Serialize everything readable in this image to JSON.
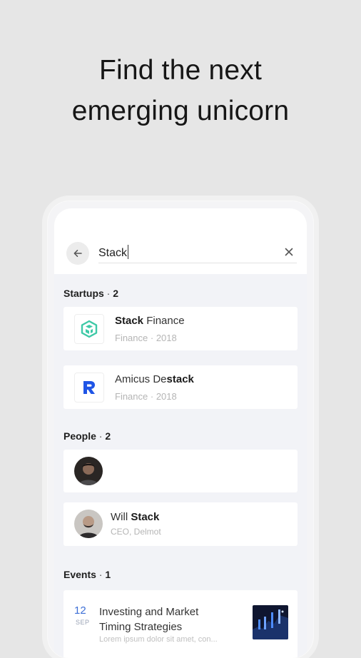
{
  "headline": {
    "line1": "Find the next",
    "line2": "emerging unicorn"
  },
  "search": {
    "query": "Stack"
  },
  "sections": {
    "startups": {
      "label": "Startups",
      "count": "2"
    },
    "people": {
      "label": "People",
      "count": "2"
    },
    "events": {
      "label": "Events",
      "count": "1"
    }
  },
  "startups": [
    {
      "name_highlight": "Stack",
      "name_rest": " Finance",
      "category": "Finance",
      "year": "2018",
      "logo": "stack-finance-logo",
      "logo_color": "#3ec9a7"
    },
    {
      "name_prefix": "Amicus De",
      "name_highlight": "stack",
      "category": "Finance",
      "year": "2018",
      "logo": "amicus-logo",
      "logo_color": "#1f55e6"
    }
  ],
  "people": [
    {
      "avatar": "avatar-person-1"
    },
    {
      "first_name": "Will ",
      "name_highlight": "Stack",
      "role": "CEO, Delmot",
      "avatar": "avatar-person-2"
    }
  ],
  "events": [
    {
      "day": "12",
      "month": "SEP",
      "title": "Investing and Market Timing Strategies",
      "description": "Lorem ipsum dolor sit amet, con..."
    }
  ],
  "colors": {
    "accent_date": "#3d6fd6",
    "page_bg": "#e6e6e6",
    "screen_bg": "#f2f3f7"
  }
}
